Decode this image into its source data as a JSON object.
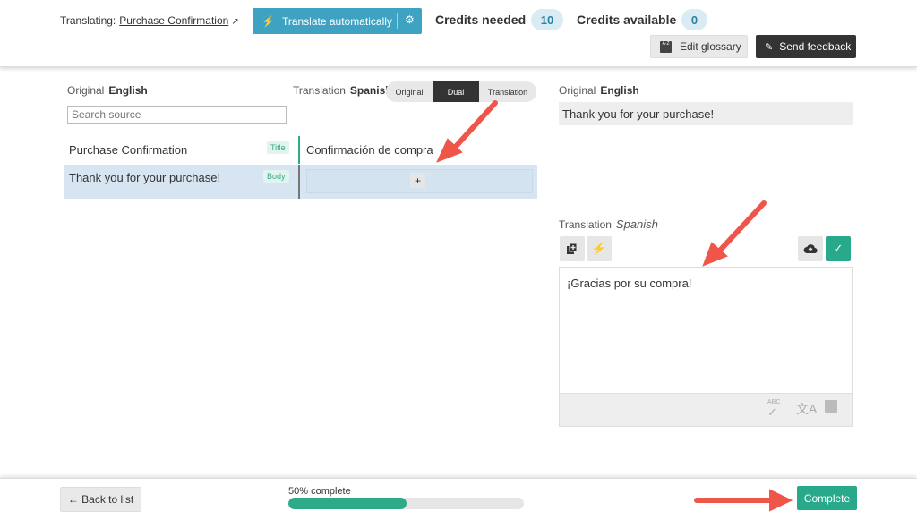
{
  "header": {
    "translating_label": "Translating:",
    "translating_link": "Purchase Confirmation",
    "translate_button": "Translate automatically",
    "credits_needed_label": "Credits needed",
    "credits_needed_value": "10",
    "credits_available_label": "Credits available",
    "credits_available_value": "0",
    "edit_glossary": "Edit glossary",
    "send_feedback": "Send feedback"
  },
  "left_pane": {
    "original_label": "Original",
    "original_lang": "English",
    "translation_label": "Translation",
    "translation_lang": "Spanish",
    "search_placeholder": "Search source",
    "view_modes": [
      "Original",
      "Dual",
      "Translation"
    ],
    "active_view_mode": "Dual",
    "rows": [
      {
        "source": "Purchase Confirmation",
        "tag": "Title",
        "translation": "Confirmación de compra"
      },
      {
        "source": "Thank you for your purchase!",
        "tag": "Body",
        "translation": ""
      }
    ],
    "add_symbol": "+"
  },
  "right_pane": {
    "original_label": "Original",
    "original_lang": "English",
    "source_text": "Thank you for your purchase!",
    "translation_label": "Translation",
    "translation_lang": "Spanish",
    "translation_text": "¡Gracias por su compra!",
    "abc_text": "ABC"
  },
  "footer": {
    "back_button": "← Back to list",
    "progress_label": "50% complete",
    "progress_fraction": 0.5,
    "complete_button": "Complete"
  },
  "colors": {
    "accent_blue": "#3ea2c3",
    "accent_green": "#29a98b",
    "annotation_arrow": "#f0554a"
  }
}
